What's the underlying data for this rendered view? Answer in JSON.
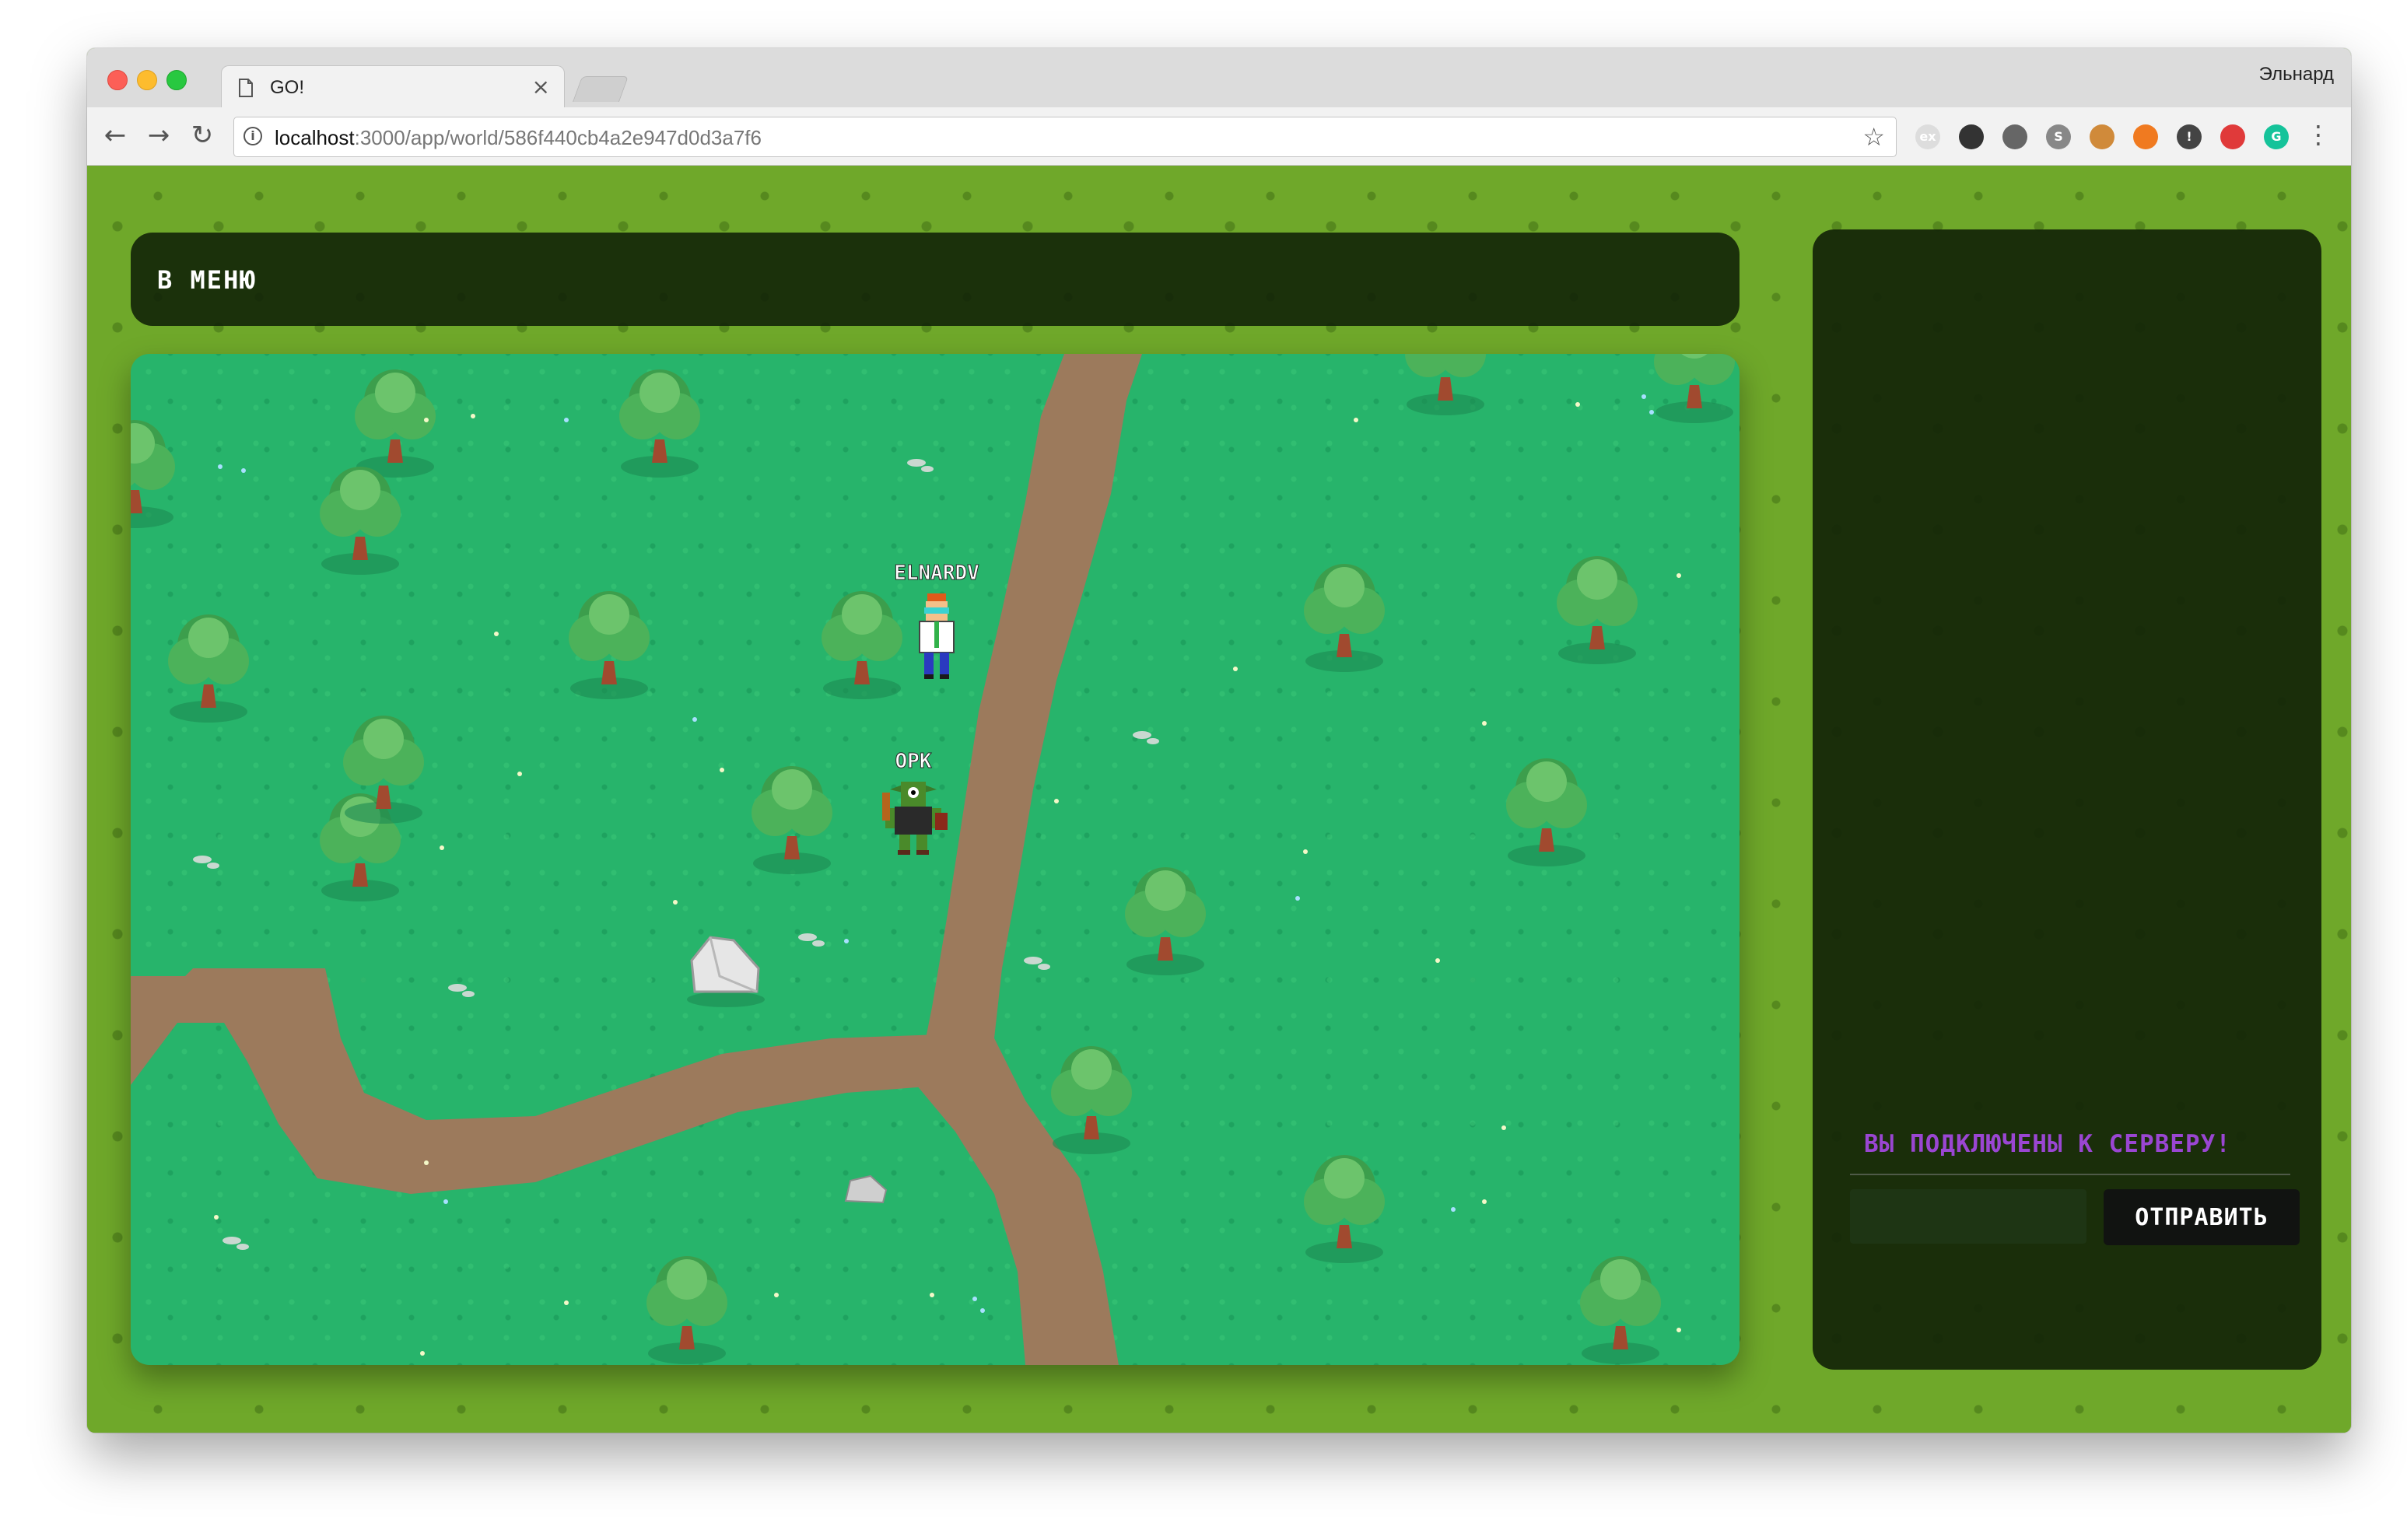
{
  "browser": {
    "tab_title": "GO!",
    "tab_close": "×",
    "profile_name": "Эльнард",
    "url_host": "localhost",
    "url_path": ":3000/app/world/586f440cb4a2e947d0d3a7f6",
    "nav": {
      "back": "←",
      "forward": "→",
      "reload": "↻",
      "star": "☆",
      "menu": "⋮"
    },
    "extensions": [
      {
        "name": "ex-extension-icon",
        "label": "ex",
        "color": "#dddddd"
      },
      {
        "name": "shield-extension-icon",
        "label": "",
        "color": "#333333"
      },
      {
        "name": "ublock-extension-icon",
        "label": "",
        "color": "#666666"
      },
      {
        "name": "s-extension-icon",
        "label": "S",
        "color": "#888888"
      },
      {
        "name": "cookie-extension-icon",
        "label": "",
        "color": "#d08a3a"
      },
      {
        "name": "orange-extension-icon",
        "label": "",
        "color": "#f07a20"
      },
      {
        "name": "info-extension-icon",
        "label": "!",
        "color": "#444444"
      },
      {
        "name": "red-extension-icon",
        "label": "",
        "color": "#e03a3a"
      },
      {
        "name": "grammarly-extension-icon",
        "label": "G",
        "color": "#15c39a"
      }
    ]
  },
  "game": {
    "menu_button": "В МЕНЮ",
    "players": [
      {
        "name": "ELNARDV",
        "type": "player"
      },
      {
        "name": "ОРК",
        "type": "npc"
      }
    ],
    "chat": {
      "status_message": "ВЫ ПОДКЛЮЧЕНЫ К СЕРВЕРУ!",
      "input_value": "",
      "send_button": "ОТПРАВИТЬ"
    },
    "colors": {
      "background_grass": "#6fa82a",
      "map_grass": "#27b46b",
      "path": "#9c7a5c",
      "panel": "#122408",
      "status_text": "#9a46d2"
    }
  }
}
